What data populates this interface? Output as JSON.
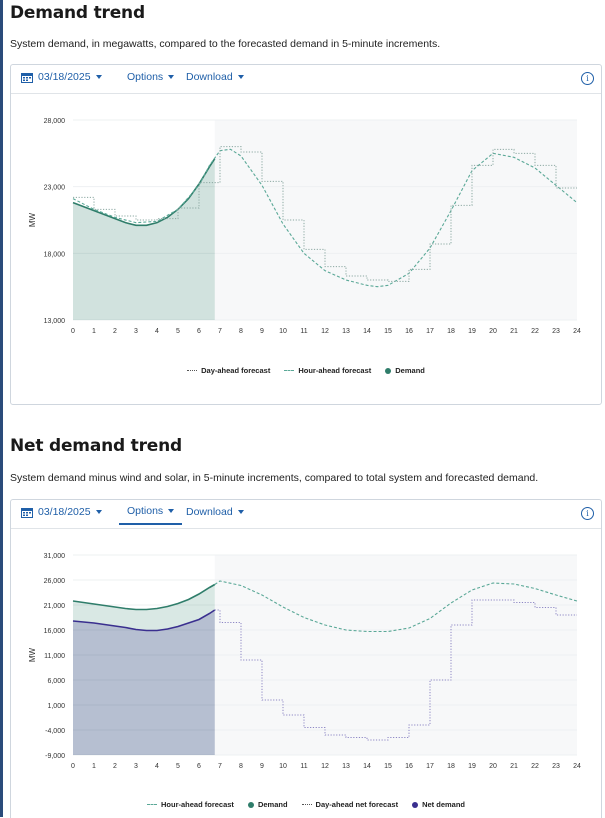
{
  "demand_section": {
    "title": "Demand trend",
    "description": "System demand, in megawatts, compared to the forecasted demand in 5-minute increments.",
    "toolbar": {
      "date": "03/18/2025",
      "options_label": "Options",
      "download_label": "Download"
    },
    "legend": [
      {
        "label": "Day-ahead forecast",
        "style": "dotted",
        "color": "#5c6a72"
      },
      {
        "label": "Hour-ahead forecast",
        "style": "dashed",
        "color": "#5aa897"
      },
      {
        "label": "Demand",
        "style": "dot",
        "color": "#2f7d6a"
      }
    ]
  },
  "net_demand_section": {
    "title": "Net demand trend",
    "description": "System demand minus wind and solar, in 5-minute increments, compared to total system and forecasted demand.",
    "toolbar": {
      "date": "03/18/2025",
      "options_label": "Options",
      "download_label": "Download"
    },
    "legend": [
      {
        "label": "Hour-ahead forecast",
        "style": "dashed",
        "color": "#5aa897"
      },
      {
        "label": "Demand",
        "style": "dot",
        "color": "#2f7d6a"
      },
      {
        "label": "Day-ahead net forecast",
        "style": "dotted",
        "color": "#5c6a72"
      },
      {
        "label": "Net demand",
        "style": "dot",
        "color": "#3a2f8f"
      }
    ]
  },
  "colors": {
    "accent": "#1f5fa8",
    "demand": "#2f7d6a",
    "net_demand": "#3a2f8f",
    "hour_ahead": "#5aa897"
  },
  "chart_data": [
    {
      "type": "line",
      "title": "",
      "xlabel": "",
      "ylabel": "MW",
      "xlim": [
        0,
        24
      ],
      "ylim": [
        13000,
        28000
      ],
      "x_ticks": [
        "0",
        "1",
        "2",
        "3",
        "4",
        "5",
        "6",
        "7",
        "8",
        "9",
        "10",
        "11",
        "12",
        "13",
        "14",
        "15",
        "16",
        "17",
        "18",
        "19",
        "20",
        "21",
        "22",
        "23",
        "24"
      ],
      "y_ticks": [
        "13,000",
        "18,000",
        "23,000",
        "28,000"
      ],
      "series": [
        {
          "name": "Demand",
          "type": "area",
          "x": [
            0,
            0.5,
            1,
            1.5,
            2,
            2.5,
            3,
            3.5,
            4,
            4.5,
            5,
            5.5,
            6,
            6.5,
            6.75
          ],
          "y": [
            21800,
            21500,
            21200,
            20900,
            20600,
            20300,
            20100,
            20100,
            20300,
            20700,
            21300,
            22100,
            23200,
            24500,
            25100
          ]
        },
        {
          "name": "Hour-ahead forecast",
          "type": "line",
          "x": [
            0,
            1,
            2,
            3,
            4,
            5,
            6,
            6.5,
            7,
            7.5,
            8,
            9,
            10,
            11,
            12,
            13,
            14,
            14.5,
            15,
            16,
            17,
            18,
            19,
            20,
            21,
            22,
            23,
            24
          ],
          "y": [
            22100,
            21300,
            20700,
            20300,
            20400,
            21300,
            23100,
            24600,
            25700,
            25800,
            25300,
            23100,
            20200,
            18000,
            16700,
            16000,
            15600,
            15500,
            15600,
            16500,
            18400,
            21200,
            24200,
            25500,
            25200,
            24400,
            23100,
            21800
          ]
        },
        {
          "name": "Day-ahead forecast",
          "type": "step",
          "x": [
            0,
            1,
            2,
            3,
            4,
            5,
            6,
            7,
            8,
            9,
            10,
            11,
            12,
            13,
            14,
            15,
            16,
            17,
            18,
            19,
            20,
            21,
            22,
            23,
            24
          ],
          "y": [
            22200,
            21300,
            20800,
            20500,
            20600,
            21400,
            23300,
            26000,
            25600,
            23400,
            20500,
            18300,
            17000,
            16300,
            16000,
            15900,
            16800,
            18700,
            21600,
            24600,
            25800,
            25500,
            24600,
            22900,
            22900
          ]
        }
      ]
    },
    {
      "type": "line",
      "title": "",
      "xlabel": "",
      "ylabel": "MW",
      "xlim": [
        0,
        24
      ],
      "ylim": [
        -9000,
        31000
      ],
      "x_ticks": [
        "0",
        "1",
        "2",
        "3",
        "4",
        "5",
        "6",
        "7",
        "8",
        "9",
        "10",
        "11",
        "12",
        "13",
        "14",
        "15",
        "16",
        "17",
        "18",
        "19",
        "20",
        "21",
        "22",
        "23",
        "24"
      ],
      "y_ticks": [
        "-9,000",
        "-4,000",
        "1,000",
        "6,000",
        "11,000",
        "16,000",
        "21,000",
        "26,000",
        "31,000"
      ],
      "series": [
        {
          "name": "Demand",
          "type": "area",
          "x": [
            0,
            0.5,
            1,
            1.5,
            2,
            2.5,
            3,
            3.5,
            4,
            4.5,
            5,
            5.5,
            6,
            6.5,
            6.75
          ],
          "y": [
            21800,
            21500,
            21200,
            20900,
            20600,
            20300,
            20100,
            20100,
            20300,
            20700,
            21300,
            22100,
            23200,
            24500,
            25100
          ]
        },
        {
          "name": "Net demand",
          "type": "area",
          "x": [
            0,
            0.5,
            1,
            1.5,
            2,
            2.5,
            3,
            3.5,
            4,
            4.5,
            5,
            5.5,
            6,
            6.5,
            6.75
          ],
          "y": [
            17800,
            17600,
            17400,
            17100,
            16800,
            16500,
            16100,
            15900,
            15900,
            16200,
            16700,
            17400,
            18100,
            19300,
            20000
          ]
        },
        {
          "name": "Hour-ahead forecast",
          "type": "line",
          "x": [
            6.75,
            7,
            8,
            9,
            10,
            11,
            12,
            13,
            14,
            15,
            16,
            17,
            18,
            19,
            20,
            21,
            22,
            23,
            24
          ],
          "y": [
            25100,
            25800,
            24900,
            23000,
            20600,
            18500,
            17000,
            16000,
            15700,
            15700,
            16400,
            18300,
            21400,
            24000,
            25400,
            25200,
            24300,
            23000,
            21800
          ]
        },
        {
          "name": "Day-ahead net forecast",
          "type": "step",
          "x": [
            6.75,
            7,
            8,
            9,
            10,
            11,
            12,
            13,
            14,
            15,
            16,
            17,
            18,
            19,
            20,
            21,
            22,
            23,
            24
          ],
          "y": [
            20000,
            17500,
            10000,
            2000,
            -1000,
            -3500,
            -5000,
            -5500,
            -6000,
            -5500,
            -3000,
            6000,
            17000,
            22000,
            22000,
            21500,
            20500,
            19000,
            19000
          ]
        }
      ]
    }
  ]
}
